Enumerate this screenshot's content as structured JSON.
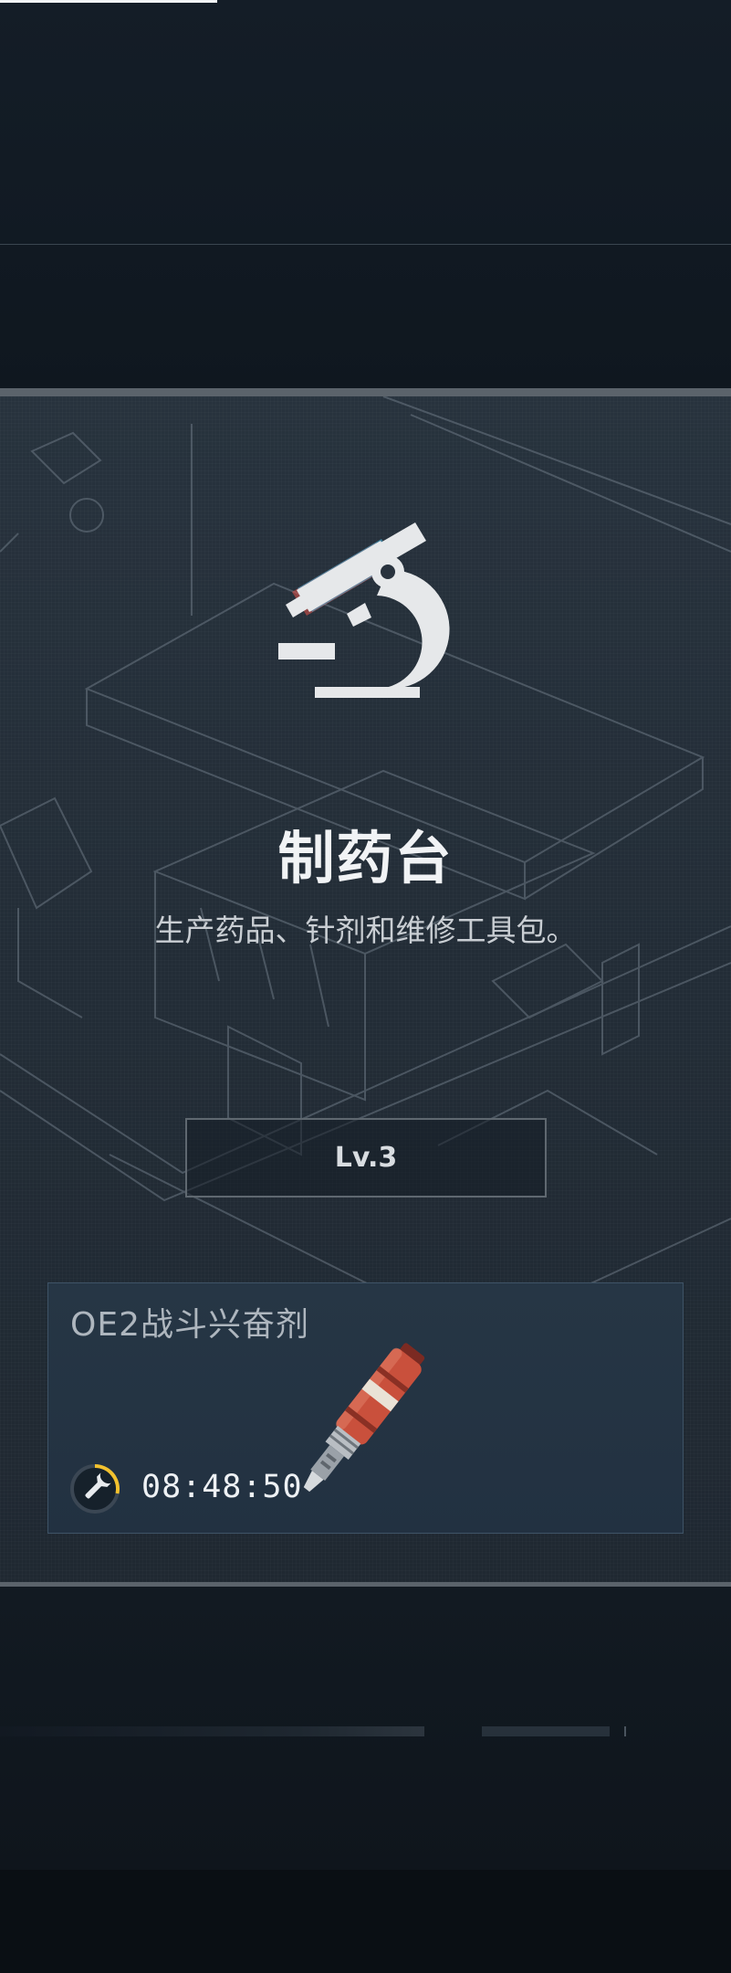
{
  "station": {
    "icon": "microscope-icon",
    "title": "制药台",
    "description": "生产药品、针剂和维修工具包。",
    "level": "Lv.3"
  },
  "craft": {
    "item_name": "OE2战斗兴奋剂",
    "item_icon": "stimulant-injector-icon",
    "timer_icon": "wrench-icon",
    "time_remaining": "08:48:50"
  },
  "colors": {
    "panel_bg": "#242f3a",
    "card_bg": "#243343",
    "accent_timer": "#f2c12e",
    "item_red": "#c9503c"
  }
}
